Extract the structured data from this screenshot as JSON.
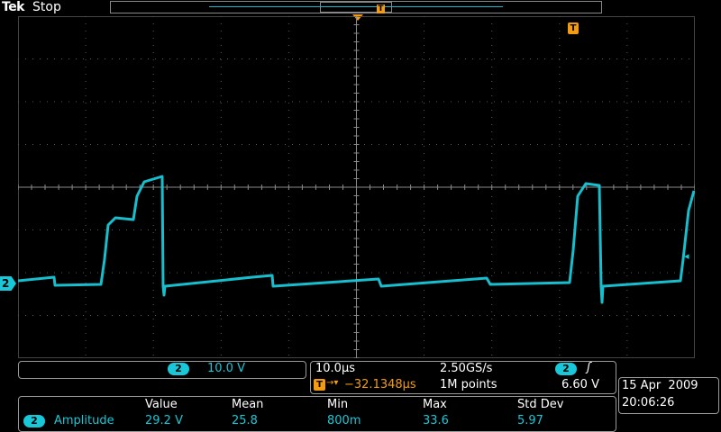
{
  "header": {
    "brand": "Tek",
    "run_state": "Stop"
  },
  "markers": {
    "trigger_icon": "T",
    "channel": "2",
    "trigger_level_icon": "arrow-left-icon"
  },
  "channel": {
    "number": "2",
    "scale": "10.0 V"
  },
  "timebase": {
    "scale": "10.0µs",
    "sample_rate": "2.50GS/s",
    "trigger_channel": "2",
    "trigger_edge": "rising-edge-icon",
    "delay_label": "T",
    "delay": "−32.1348µs",
    "record_length": "1M points",
    "trigger_level": "6.60 V"
  },
  "datetime": {
    "date": "15 Apr  2009",
    "time": "20:06:26"
  },
  "measurement": {
    "headers": [
      "Value",
      "Mean",
      "Min",
      "Max",
      "Std Dev"
    ],
    "channel": "2",
    "name": "Amplitude",
    "values": [
      "29.2 V",
      "25.8",
      "800m",
      "33.6",
      "5.97"
    ]
  },
  "colors": {
    "trace": "#18c8d8",
    "trigger": "#f39c12",
    "grid": "#5a5a5a"
  }
}
